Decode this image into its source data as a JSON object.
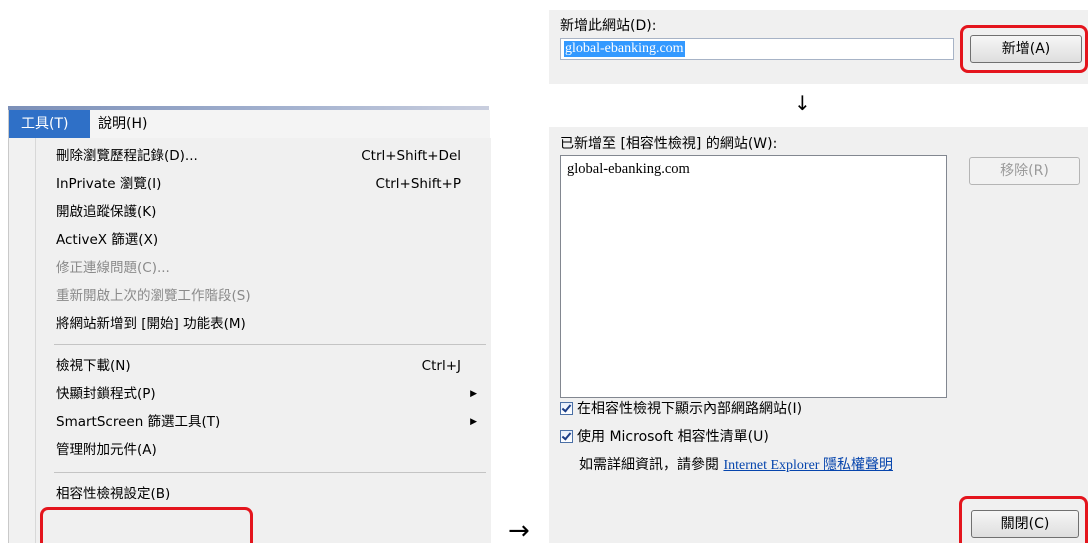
{
  "menu": {
    "bar": {
      "tools_label": "工具(T)",
      "help_label": "說明(H)"
    },
    "items": [
      {
        "label": "刪除瀏覽歷程記錄(D)...",
        "shortcut": "Ctrl+Shift+Del"
      },
      {
        "label": "InPrivate 瀏覽(I)",
        "shortcut": "Ctrl+Shift+P"
      },
      {
        "label": "開啟追蹤保護(K)"
      },
      {
        "label": "ActiveX 篩選(X)"
      },
      {
        "label": "修正連線問題(C)...",
        "disabled": true
      },
      {
        "label": "重新開啟上次的瀏覽工作階段(S)",
        "disabled": true
      },
      {
        "label": "將網站新增到 [開始] 功能表(M)"
      },
      {
        "label": "檢視下載(N)",
        "shortcut": "Ctrl+J"
      },
      {
        "label": "快顯封鎖程式(P)",
        "submenu_icon": "submenu-arrow-icon"
      },
      {
        "label": "SmartScreen 篩選工具(T)",
        "submenu_icon": "submenu-arrow-icon"
      },
      {
        "label": "管理附加元件(A)"
      },
      {
        "label": "相容性檢視設定(B)"
      }
    ]
  },
  "arrows": {
    "right": "→",
    "down": "↓"
  },
  "dialog": {
    "add_site_label": "新增此網站(D):",
    "add_site_value": "global-ebanking.com",
    "add_button": "新增(A)",
    "sites_label": "已新增至 [相容性檢視] 的網站(W):",
    "sites": [
      "global-ebanking.com"
    ],
    "remove_button": "移除(R)",
    "checkbox_intranet": "在相容性檢視下顯示內部網路網站(I)",
    "checkbox_ms_list": "使用 Microsoft 相容性清單(U)",
    "info_text": "如需詳細資訊，請參閱",
    "info_link": "Internet Explorer 隱私權聲明",
    "close_button": "關閉(C)"
  },
  "colors": {
    "highlight_red": "#e4151d",
    "menu_selected": "#2f70c7",
    "link": "#0645ad"
  }
}
